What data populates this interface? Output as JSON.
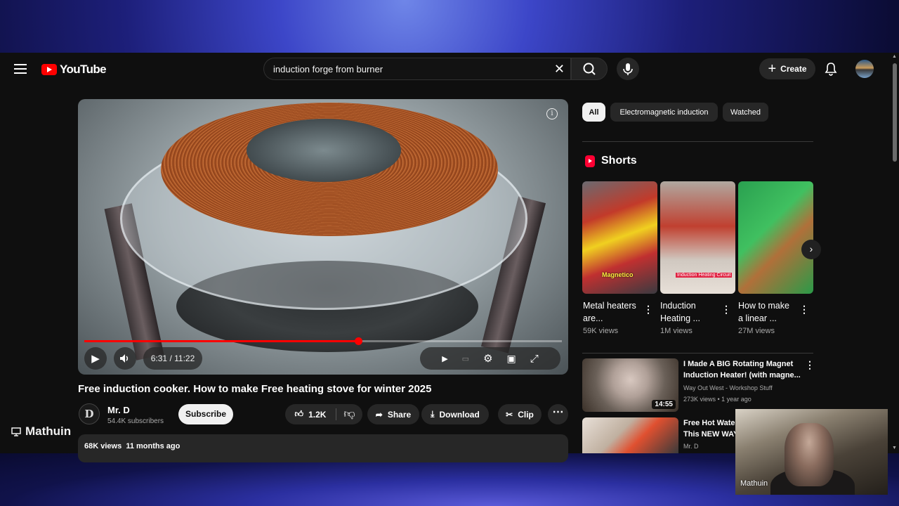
{
  "header": {
    "logo_text": "YouTube",
    "search_value": "induction forge from burner",
    "create_label": "Create"
  },
  "player": {
    "time": "6:31 / 11:22",
    "progress_fraction": 0.573
  },
  "video": {
    "title": "Free induction cooker. How to make Free heating stove for winter 2025",
    "channel_initial": "D",
    "channel_name": "Mr. D",
    "subscribers": "54.4K subscribers",
    "subscribe_label": "Subscribe",
    "likes": "1.2K",
    "share_label": "Share",
    "download_label": "Download",
    "clip_label": "Clip",
    "views": "68K views",
    "age": "11 months ago"
  },
  "watermark": "Mathuin",
  "sidebar": {
    "chips": [
      "All",
      "Electromagnetic induction",
      "Watched"
    ],
    "shorts_heading": "Shorts",
    "shorts": [
      {
        "title": "Metal heaters are...",
        "views": "59K views",
        "thumb_text": "Magnetico"
      },
      {
        "title": "Induction Heating ...",
        "views": "1M views",
        "thumb_text": "Induction Heating Circuit"
      },
      {
        "title": "How to make a linear ...",
        "views": "27M views",
        "thumb_text": ""
      }
    ],
    "related": [
      {
        "title_line1": "I Made A BIG Rotating Magnet",
        "title_line2": "Induction Heater! (with magne...",
        "channel": "Way Out West - Workshop Stuff",
        "meta": "273K views • 1 year ago",
        "duration": "14:55"
      },
      {
        "title_line1": "Free Hot Water",
        "title_line2": "This NEW WAY",
        "channel": "Mr. D",
        "meta": "",
        "duration": ""
      }
    ]
  },
  "webcam_label": "Mathuin",
  "colors": {
    "accent": "#ff0000",
    "page_bg": "#0f0f0f",
    "chip_bg": "#272727"
  }
}
